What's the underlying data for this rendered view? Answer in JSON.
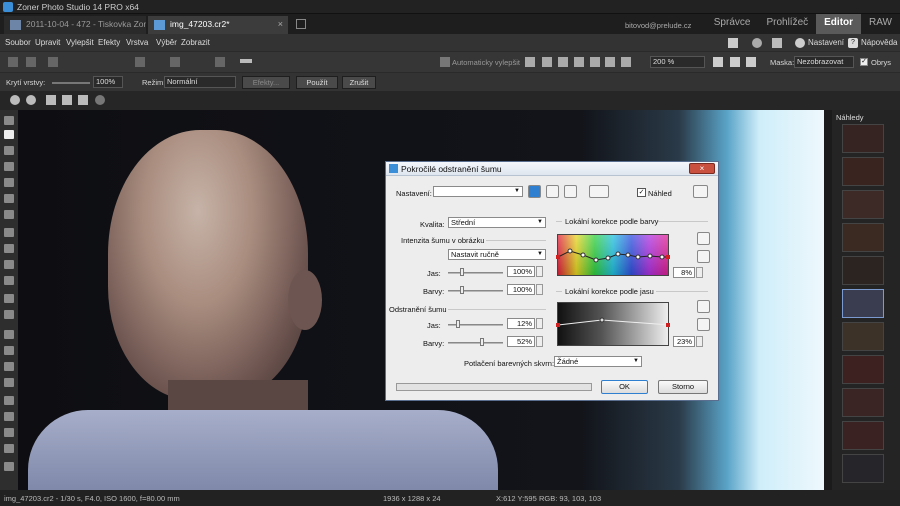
{
  "window": {
    "title": "Zoner Photo Studio 14 PRO x64"
  },
  "tabs": [
    {
      "label": "2011-10-04 - 472 - Tiskovka Zon..."
    },
    {
      "label": "img_47203.cr2*"
    }
  ],
  "account": "bitovod@prelude.cz",
  "modes": [
    "Správce",
    "Prohlížeč",
    "Editor",
    "RAW"
  ],
  "active_mode": "Editor",
  "menu": {
    "items": [
      "Soubor",
      "Upravit",
      "Vylepšit",
      "Efekty",
      "Vrstva",
      "Výběr",
      "Zobrazit"
    ],
    "settings": "Nastavení",
    "help": "Nápověda"
  },
  "toolbar": {
    "auto_enhance": "Automaticky vylepšit",
    "zoom": "200 %",
    "mask_label": "Maska:",
    "mask_value": "Nezobrazovat",
    "outline_label": "Obrys"
  },
  "layerbar": {
    "opacity_label": "Krytí vrstvy:",
    "opacity_value": "100%",
    "mode_label": "Režim:",
    "mode_value": "Normální",
    "effects_btn": "Efekty...",
    "apply_btn": "Použít",
    "cancel_btn": "Zrušit"
  },
  "right_panel": {
    "title": "Náhledy"
  },
  "status": {
    "file": "img_47203.cr2 - 1/30 s, F4.0, ISO 1600, f=80.00 mm",
    "dimensions": "1936 x 1288 x 24",
    "cursor": "X:612 Y:595",
    "rgb": "RGB: 93, 103, 103"
  },
  "dialog": {
    "title": "Pokročilé odstranění šumu",
    "preset_label": "Nastavení:",
    "preset_value": "",
    "preview_label": "Náhled",
    "quality_label": "Kvalita:",
    "quality_value": "Střední",
    "intensity_section": "Intenzita šumu v obrázku",
    "intensity_mode": "Nastavit ručně",
    "jas_label": "Jas:",
    "barvy_label": "Barvy:",
    "intensity_jas": "100%",
    "intensity_barvy": "100%",
    "removal_section": "Odstranění šumu",
    "removal_jas": "12%",
    "removal_barvy": "52%",
    "suppression_label": "Potlačení barevných skvrn:",
    "suppression_value": "Žádné",
    "color_correction": "Lokální korekce podle barvy",
    "color_pct": "8%",
    "luma_correction": "Lokální korekce podle jasu",
    "luma_pct": "23%",
    "ok": "OK",
    "cancel": "Storno"
  },
  "colors": {
    "accent": "#2f7fd1",
    "dialog_bg": "#ededed"
  }
}
